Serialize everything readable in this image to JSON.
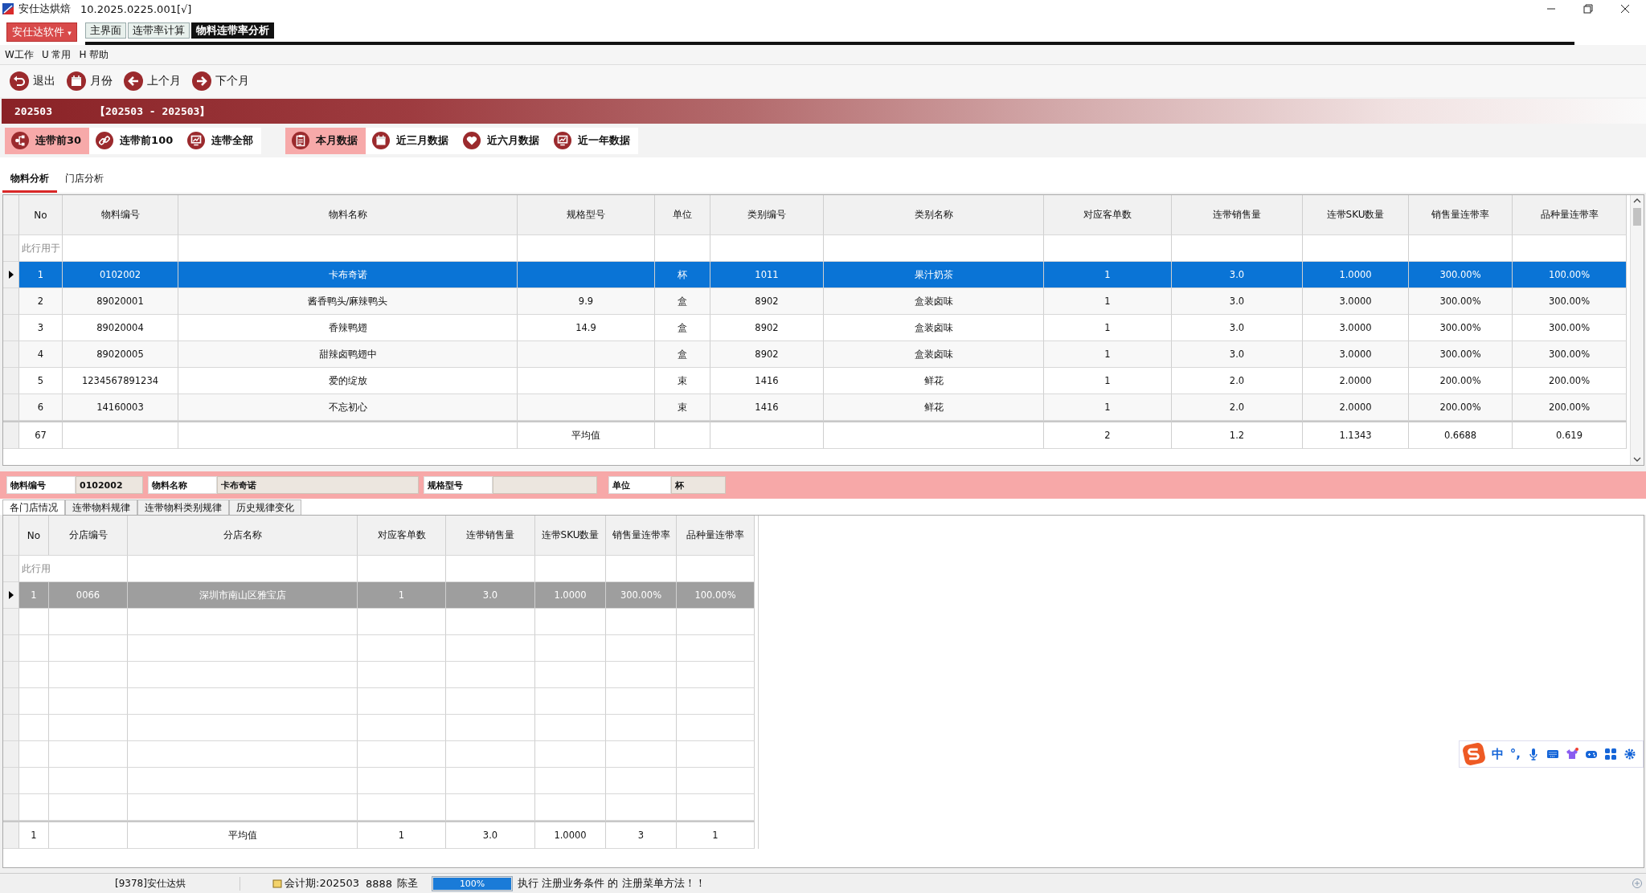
{
  "window": {
    "title": "安仕达烘焙",
    "version": "10.2025.0225.001[√]"
  },
  "app_menu": {
    "label": "安仕达软件",
    "caret": "▾"
  },
  "tabs": [
    {
      "label": "主界面",
      "selected": false
    },
    {
      "label": "连带率计算",
      "selected": false
    },
    {
      "label": "物料连带率分析",
      "selected": true
    }
  ],
  "menu": [
    "W工作",
    "U 常用",
    "H 帮助"
  ],
  "toolbar": [
    {
      "label": "退出",
      "kind": "exit"
    },
    {
      "label": "月份",
      "kind": "calendar"
    },
    {
      "label": "上个月",
      "kind": "left"
    },
    {
      "label": "下个月",
      "kind": "right"
    }
  ],
  "banner": {
    "period": "202503",
    "range": "【202503 - 202503】"
  },
  "scope_filters": [
    {
      "label": "连带前30",
      "kind": "tree",
      "selected": true
    },
    {
      "label": "连带前100",
      "kind": "link",
      "selected": false
    },
    {
      "label": "连带全部",
      "kind": "monitor",
      "selected": false
    }
  ],
  "range_filters": [
    {
      "label": "本月数据",
      "kind": "clipboard",
      "selected": true
    },
    {
      "label": "近三月数据",
      "kind": "calendar",
      "selected": false
    },
    {
      "label": "近六月数据",
      "kind": "heart",
      "selected": false
    },
    {
      "label": "近一年数据",
      "kind": "monitor",
      "selected": false
    }
  ],
  "analysis_tabs": [
    {
      "label": "物料分析",
      "selected": true
    },
    {
      "label": "门店分析",
      "selected": false
    }
  ],
  "main_table": {
    "columns": [
      "No",
      "物料编号",
      "物料名称",
      "规格型号",
      "单位",
      "类别编号",
      "类别名称",
      "对应客单数",
      "连带销售量",
      "连带SKU数量",
      "销售量连带率",
      "品种量连带率"
    ],
    "filter_hint": "此行用于",
    "rows": [
      {
        "selected": true,
        "cells": [
          "1",
          "0102002",
          "卡布奇诺",
          "",
          "杯",
          "1011",
          "果汁奶茶",
          "1",
          "3.0",
          "1.0000",
          "300.00%",
          "100.00%"
        ]
      },
      {
        "selected": false,
        "cells": [
          "2",
          "89020001",
          "酱香鸭头/麻辣鸭头",
          "9.9",
          "盒",
          "8902",
          "盒装卤味",
          "1",
          "3.0",
          "3.0000",
          "300.00%",
          "300.00%"
        ]
      },
      {
        "selected": false,
        "cells": [
          "3",
          "89020004",
          "香辣鸭翅",
          "14.9",
          "盒",
          "8902",
          "盒装卤味",
          "1",
          "3.0",
          "3.0000",
          "300.00%",
          "300.00%"
        ]
      },
      {
        "selected": false,
        "cells": [
          "4",
          "89020005",
          "甜辣卤鸭翅中",
          "",
          "盒",
          "8902",
          "盒装卤味",
          "1",
          "3.0",
          "3.0000",
          "300.00%",
          "300.00%"
        ]
      },
      {
        "selected": false,
        "cells": [
          "5",
          "1234567891234",
          "爱的绽放",
          "",
          "束",
          "1416",
          "鲜花",
          "1",
          "2.0",
          "2.0000",
          "200.00%",
          "200.00%"
        ]
      },
      {
        "selected": false,
        "cells": [
          "6",
          "14160003",
          "不忘初心",
          "",
          "束",
          "1416",
          "鲜花",
          "1",
          "2.0",
          "2.0000",
          "200.00%",
          "200.00%"
        ]
      }
    ],
    "footer": {
      "count": "67",
      "label": "平均值",
      "customers": "2",
      "sales": "1.2",
      "sku": "1.1343",
      "sales_rate": "0.6688",
      "variety_rate": "0.619"
    }
  },
  "detail_fields": [
    {
      "label": "物料编号",
      "value": "0102002"
    },
    {
      "label": "物料名称",
      "value": "卡布奇诺"
    },
    {
      "label": "规格型号"
    },
    {
      "label": "单位",
      "value": "杯"
    }
  ],
  "detail_tabs": [
    {
      "label": "各门店情况",
      "selected": true
    },
    {
      "label": "连带物料规律",
      "selected": false
    },
    {
      "label": "连带物料类别规律",
      "selected": false
    },
    {
      "label": "历史规律变化",
      "selected": false
    }
  ],
  "store_table": {
    "columns": [
      "No",
      "分店编号",
      "分店名称",
      "对应客单数",
      "连带销售量",
      "连带SKU数量",
      "销售量连带率",
      "品种量连带率"
    ],
    "filter_hint": "此行用",
    "rows": [
      {
        "selected": true,
        "cells": [
          "1",
          "0066",
          "深圳市南山区雅宝店",
          "1",
          "3.0",
          "1.0000",
          "300.00%",
          "100.00%"
        ]
      }
    ],
    "footer": {
      "count": "1",
      "label": "平均值",
      "customers": "1",
      "sales": "3.0",
      "sku": "1.0000",
      "sales_rate": "3",
      "variety_rate": "1"
    }
  },
  "ime_toolbar": {
    "mode": "中",
    "punctuation": "°,"
  },
  "status_bar": {
    "user": "[9378]安仕达烘",
    "period": "会计期:202503",
    "operator_code": "8888",
    "operator": "陈圣",
    "progress": {
      "level": 1,
      "text": "100%"
    },
    "message": "执行 注册业务条件 的 注册菜单方法！！"
  }
}
